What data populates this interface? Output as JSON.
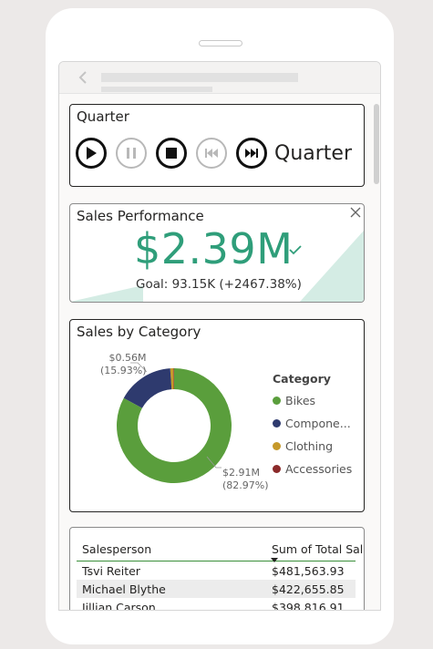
{
  "quarter_slicer": {
    "title": "Quarter",
    "buttons": [
      "play",
      "pause",
      "stop",
      "previous",
      "next"
    ],
    "current_label": "Quarter"
  },
  "kpi": {
    "title": "Sales Performance",
    "value": "$2.39M",
    "goal_text": "Goal: 93.15K (+2467.38%)",
    "color": "#2f9e7a",
    "trend_color": "#d4ece4"
  },
  "category_chart": {
    "title": "Sales by Category",
    "legend_title": "Category",
    "legend": [
      {
        "label": "Bikes",
        "color": "#5a9e3c"
      },
      {
        "label": "Compone...",
        "color": "#2e3a6e"
      },
      {
        "label": "Clothing",
        "color": "#c6992a"
      },
      {
        "label": "Accessories",
        "color": "#8b2a2a"
      }
    ],
    "labels": {
      "small_value": "$0.56M",
      "small_pct": "(15.93%)",
      "large_value": "$2.91M",
      "large_pct": "(82.97%)"
    }
  },
  "chart_data": {
    "type": "pie",
    "categories": [
      "Bikes",
      "Components",
      "Clothing",
      "Accessories"
    ],
    "values": [
      82.97,
      15.93,
      0.9,
      0.2
    ],
    "unit": "%",
    "colors": [
      "#5a9e3c",
      "#2e3a6e",
      "#c6992a",
      "#8b2a2a"
    ]
  },
  "sales_table": {
    "columns": [
      "Salesperson",
      "Sum of Total Sal"
    ],
    "rows": [
      {
        "name": "Tsvi Reiter",
        "total": "$481,563.93"
      },
      {
        "name": "Michael Blythe",
        "total": "$422,655.85"
      },
      {
        "name": "Jillian Carson",
        "total": "$398,816.91"
      }
    ]
  }
}
